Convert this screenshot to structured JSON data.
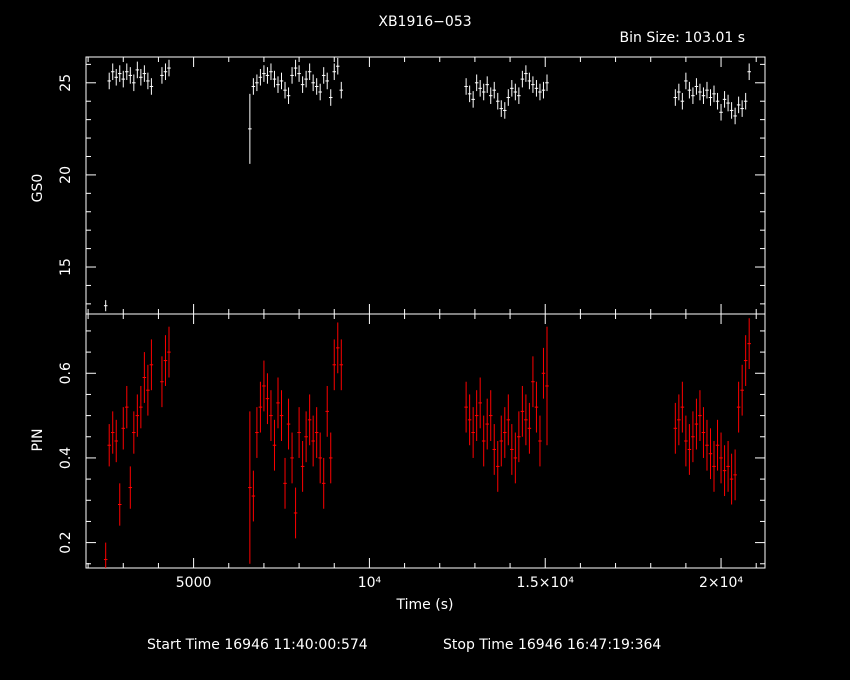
{
  "header": {
    "title": "XB1916−053",
    "bin_size": "Bin Size: 103.01 s"
  },
  "footer": {
    "start_time": "Start Time 16946 11:40:00:574",
    "stop_time": "Stop Time 16946 16:47:19:364"
  },
  "colors": {
    "top_series": "#ffffff",
    "bottom_series": "#ff0000",
    "axes": "#ffffff",
    "background": "#000000"
  },
  "chart_data": [
    {
      "type": "scatter",
      "title": "XB1916−053",
      "ylabel": "GS0",
      "xlim": [
        1940,
        21250
      ],
      "ylim": [
        12.45,
        26.4
      ],
      "yticks": [
        15,
        20,
        25
      ],
      "xticks": [],
      "grid": false,
      "series": [
        {
          "color": "#ffffff",
          "x": [
            2500,
            2600,
            2700,
            2800,
            2900,
            3000,
            3100,
            3200,
            3300,
            3400,
            3500,
            3600,
            3700,
            3800,
            4100,
            4200,
            4300,
            6600,
            6700,
            6800,
            6900,
            7000,
            7100,
            7200,
            7300,
            7400,
            7500,
            7600,
            7700,
            7800,
            7900,
            8000,
            8100,
            8200,
            8300,
            8400,
            8500,
            8600,
            8700,
            8800,
            8900,
            9000,
            9100,
            9200,
            12750,
            12850,
            12950,
            13050,
            13150,
            13250,
            13350,
            13450,
            13550,
            13650,
            13750,
            13850,
            13950,
            14050,
            14150,
            14250,
            14350,
            14450,
            14550,
            14650,
            14750,
            14850,
            14950,
            15050,
            18700,
            18800,
            18900,
            19000,
            19100,
            19200,
            19300,
            19400,
            19500,
            19600,
            19700,
            19800,
            19900,
            20000,
            20100,
            20200,
            20300,
            20400,
            20500,
            20600,
            20700,
            20800
          ],
          "y": [
            12.9,
            25.1,
            25.6,
            25.3,
            25.5,
            25.2,
            25.6,
            25.4,
            25.0,
            25.7,
            25.3,
            25.5,
            25.1,
            24.8,
            25.4,
            25.6,
            25.8,
            22.5,
            24.8,
            25.0,
            25.3,
            25.5,
            25.4,
            25.6,
            25.2,
            24.9,
            25.1,
            24.6,
            24.3,
            25.4,
            25.8,
            25.5,
            24.9,
            25.2,
            25.6,
            25.0,
            24.8,
            24.5,
            25.4,
            25.1,
            24.2,
            25.6,
            25.9,
            24.6,
            24.8,
            24.4,
            24.1,
            25.0,
            24.7,
            24.5,
            24.9,
            24.3,
            24.6,
            24.0,
            23.6,
            23.5,
            24.2,
            24.7,
            24.5,
            24.3,
            25.2,
            25.5,
            25.1,
            24.9,
            24.7,
            24.5,
            24.6,
            25.0,
            24.2,
            24.5,
            24.0,
            25.1,
            24.6,
            24.3,
            24.8,
            24.5,
            24.3,
            24.6,
            24.2,
            24.4,
            24.0,
            23.4,
            24.1,
            23.9,
            23.5,
            23.2,
            23.8,
            23.6,
            24.0,
            25.6
          ],
          "err": [
            0.3,
            0.45,
            0.45,
            0.45,
            0.45,
            0.45,
            0.45,
            0.45,
            0.45,
            0.45,
            0.45,
            0.45,
            0.45,
            0.45,
            0.45,
            0.45,
            0.45,
            1.9,
            0.45,
            0.45,
            0.45,
            0.45,
            0.45,
            0.45,
            0.45,
            0.45,
            0.45,
            0.45,
            0.45,
            0.45,
            0.45,
            0.45,
            0.45,
            0.45,
            0.45,
            0.45,
            0.45,
            0.45,
            0.45,
            0.45,
            0.45,
            0.45,
            0.45,
            0.45,
            0.45,
            0.45,
            0.45,
            0.45,
            0.45,
            0.45,
            0.45,
            0.45,
            0.45,
            0.45,
            0.45,
            0.45,
            0.45,
            0.45,
            0.45,
            0.45,
            0.45,
            0.45,
            0.45,
            0.45,
            0.45,
            0.45,
            0.45,
            0.45,
            0.45,
            0.45,
            0.45,
            0.45,
            0.45,
            0.45,
            0.45,
            0.45,
            0.45,
            0.45,
            0.45,
            0.45,
            0.45,
            0.45,
            0.45,
            0.45,
            0.45,
            0.45,
            0.45,
            0.45,
            0.45,
            0.45
          ]
        }
      ]
    },
    {
      "type": "scatter",
      "xlabel": "Time (s)",
      "ylabel": "PIN",
      "xlim": [
        1940,
        21250
      ],
      "ylim": [
        0.14,
        0.74
      ],
      "yticks": [
        "0.2",
        "0.4",
        "0.6"
      ],
      "xticks": [
        "5000",
        "10⁴",
        "1.5×10⁴",
        "2×10⁴"
      ],
      "grid": false,
      "series": [
        {
          "color": "#ff0000",
          "x": [
            2500,
            2600,
            2700,
            2800,
            2900,
            3000,
            3100,
            3200,
            3300,
            3400,
            3500,
            3600,
            3700,
            3800,
            4100,
            4200,
            4300,
            6600,
            6700,
            6800,
            6900,
            7000,
            7100,
            7200,
            7300,
            7400,
            7500,
            7600,
            7700,
            7800,
            7900,
            8000,
            8100,
            8200,
            8300,
            8400,
            8500,
            8600,
            8700,
            8800,
            8900,
            9000,
            9100,
            9200,
            12750,
            12850,
            12950,
            13050,
            13150,
            13250,
            13350,
            13450,
            13550,
            13650,
            13750,
            13850,
            13950,
            14050,
            14150,
            14250,
            14350,
            14450,
            14550,
            14650,
            14750,
            14850,
            14950,
            15050,
            18700,
            18800,
            18900,
            19000,
            19100,
            19200,
            19300,
            19400,
            19500,
            19600,
            19700,
            19800,
            19900,
            20000,
            20100,
            20200,
            20300,
            20400,
            20500,
            20600,
            20700,
            20800
          ],
          "y": [
            0.16,
            0.43,
            0.46,
            0.44,
            0.29,
            0.47,
            0.52,
            0.33,
            0.46,
            0.5,
            0.52,
            0.59,
            0.56,
            0.62,
            0.58,
            0.63,
            0.65,
            0.33,
            0.31,
            0.46,
            0.52,
            0.57,
            0.54,
            0.5,
            0.43,
            0.53,
            0.5,
            0.34,
            0.48,
            0.4,
            0.27,
            0.46,
            0.38,
            0.45,
            0.49,
            0.44,
            0.46,
            0.4,
            0.34,
            0.51,
            0.4,
            0.62,
            0.66,
            0.62,
            0.52,
            0.49,
            0.46,
            0.5,
            0.53,
            0.44,
            0.48,
            0.5,
            0.42,
            0.38,
            0.44,
            0.46,
            0.49,
            0.42,
            0.4,
            0.45,
            0.51,
            0.49,
            0.47,
            0.58,
            0.52,
            0.44,
            0.6,
            0.57,
            0.47,
            0.49,
            0.52,
            0.44,
            0.42,
            0.45,
            0.48,
            0.5,
            0.46,
            0.43,
            0.41,
            0.38,
            0.43,
            0.4,
            0.37,
            0.38,
            0.35,
            0.36,
            0.52,
            0.56,
            0.63,
            0.67
          ],
          "err": [
            0.04,
            0.05,
            0.05,
            0.05,
            0.05,
            0.05,
            0.05,
            0.05,
            0.05,
            0.05,
            0.05,
            0.06,
            0.06,
            0.06,
            0.06,
            0.06,
            0.06,
            0.18,
            0.06,
            0.06,
            0.06,
            0.06,
            0.06,
            0.06,
            0.06,
            0.06,
            0.06,
            0.06,
            0.06,
            0.06,
            0.06,
            0.06,
            0.06,
            0.06,
            0.06,
            0.06,
            0.06,
            0.06,
            0.06,
            0.06,
            0.06,
            0.06,
            0.06,
            0.06,
            0.06,
            0.06,
            0.06,
            0.06,
            0.06,
            0.06,
            0.06,
            0.06,
            0.06,
            0.06,
            0.06,
            0.06,
            0.06,
            0.06,
            0.06,
            0.06,
            0.06,
            0.06,
            0.06,
            0.06,
            0.06,
            0.06,
            0.06,
            0.14,
            0.06,
            0.06,
            0.06,
            0.06,
            0.06,
            0.06,
            0.06,
            0.06,
            0.06,
            0.06,
            0.06,
            0.06,
            0.06,
            0.06,
            0.06,
            0.06,
            0.06,
            0.06,
            0.06,
            0.06,
            0.06,
            0.06
          ]
        }
      ]
    }
  ]
}
